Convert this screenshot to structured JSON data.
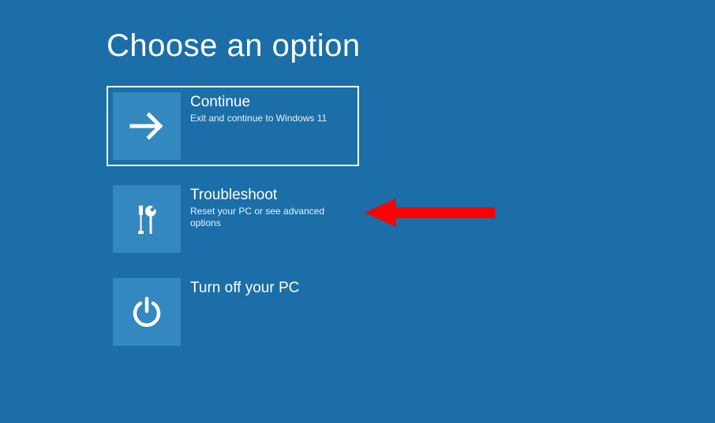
{
  "title": "Choose an option",
  "options": [
    {
      "title": "Continue",
      "desc": "Exit and continue to Windows 11",
      "icon": "arrow-right"
    },
    {
      "title": "Troubleshoot",
      "desc": "Reset your PC or see advanced options",
      "icon": "tools"
    },
    {
      "title": "Turn off your PC",
      "desc": "",
      "icon": "power"
    }
  ]
}
